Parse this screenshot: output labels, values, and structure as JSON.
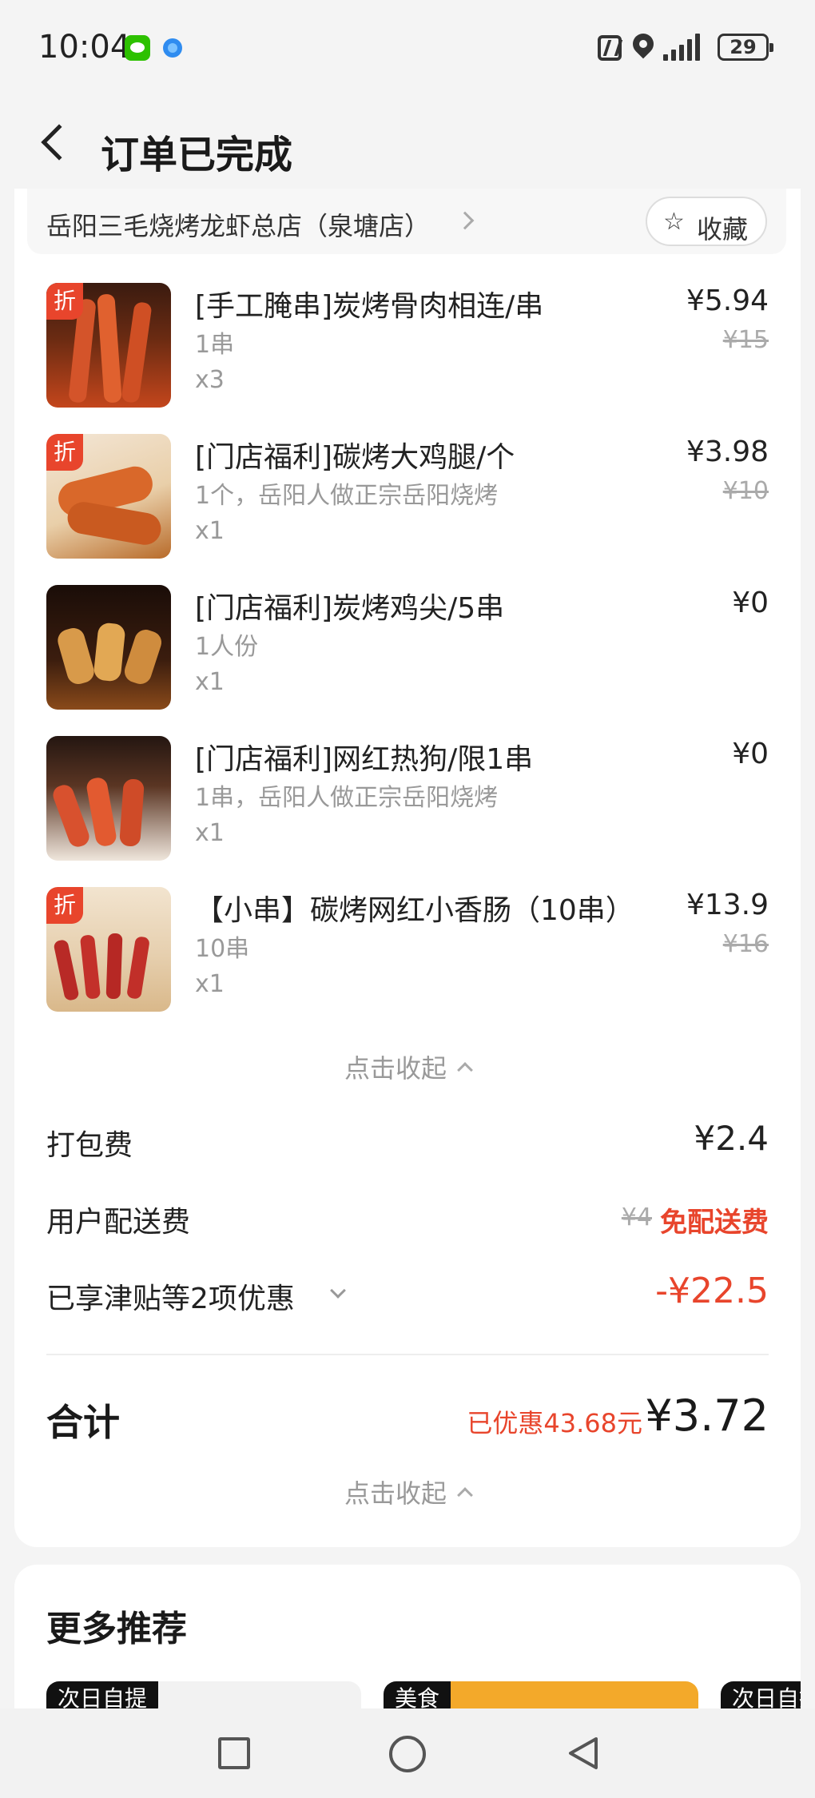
{
  "status_bar": {
    "time": "10:04",
    "battery": "29"
  },
  "header": {
    "title": "订单已完成"
  },
  "store": {
    "name": "岳阳三毛烧烤龙虾总店（泉塘店）",
    "favorite_label": "收藏"
  },
  "items": [
    {
      "name": "[手工腌串]炭烤骨肉相连/串",
      "spec": "1串",
      "qty": "x3",
      "price": "¥5.94",
      "original_price": "¥15",
      "discount_tag": "折"
    },
    {
      "name": "[门店福利]碳烤大鸡腿/个",
      "spec": "1个，岳阳人做正宗岳阳烧烤",
      "qty": "x1",
      "price": "¥3.98",
      "original_price": "¥10",
      "discount_tag": "折"
    },
    {
      "name": "[门店福利]炭烤鸡尖/5串",
      "spec": "1人份",
      "qty": "x1",
      "price": "¥0",
      "original_price": "",
      "discount_tag": ""
    },
    {
      "name": "[门店福利]网红热狗/限1串",
      "spec": "1串，岳阳人做正宗岳阳烧烤",
      "qty": "x1",
      "price": "¥0",
      "original_price": "",
      "discount_tag": ""
    },
    {
      "name": "【小串】碳烤网红小香肠（10串）",
      "spec": "10串",
      "qty": "x1",
      "price": "¥13.9",
      "original_price": "¥16",
      "discount_tag": "折"
    }
  ],
  "collapse_label": "点击收起",
  "fees": {
    "packing_label": "打包费",
    "packing_value": "¥2.4",
    "delivery_label": "用户配送费",
    "delivery_original": "¥4",
    "delivery_value": "免配送费",
    "discount_label": "已享津贴等2项优惠",
    "discount_value": "-¥22.5"
  },
  "total": {
    "label": "合计",
    "saved": "已优惠43.68元",
    "amount": "¥3.72"
  },
  "more": {
    "title": "更多推荐",
    "cards": [
      {
        "tag": "次日自提"
      },
      {
        "tag": "美食"
      },
      {
        "tag": "次日自提"
      }
    ]
  },
  "colors": {
    "accent_red": "#e8452c",
    "text_primary": "#222222",
    "text_muted": "#999999",
    "background": "#f4f4f4"
  }
}
